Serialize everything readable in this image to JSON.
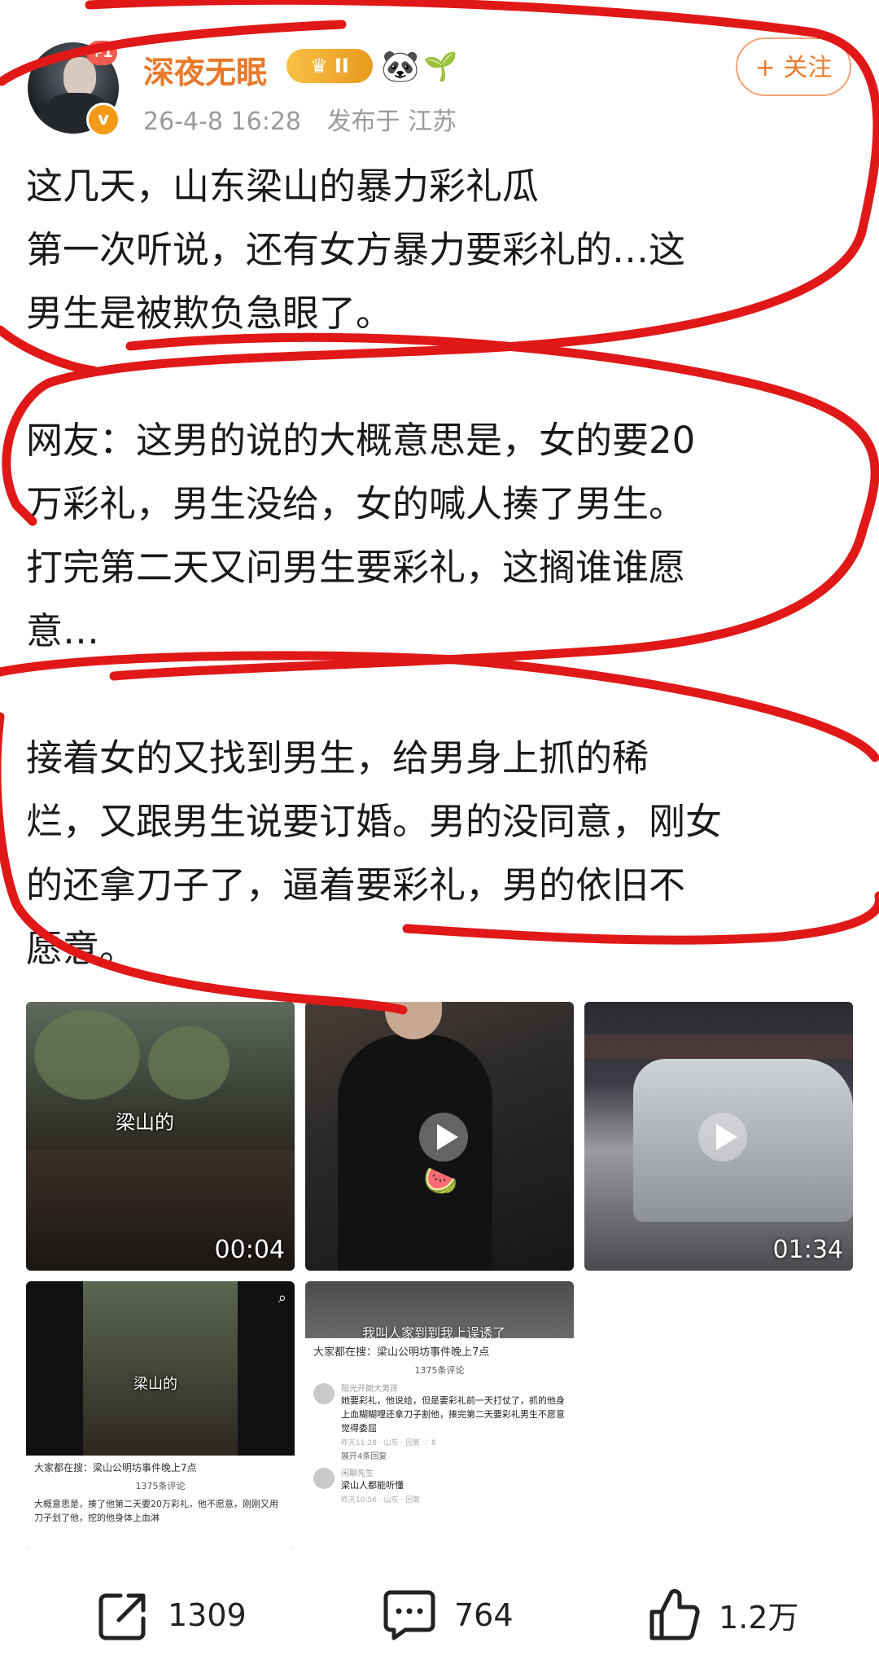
{
  "header": {
    "username": "深夜无眠",
    "plus_badge": "+1",
    "vip_badge": "II",
    "date": "26-4-8 16:28",
    "location": "发布于 江苏",
    "follow_label": "+ 关注",
    "verified_badge": "v"
  },
  "post": {
    "paragraphs": [
      [
        "这几天，山东梁山的暴力彩礼瓜",
        "第一次听说，还有女方暴力要彩礼的…这",
        "男生是被欺负急眼了。"
      ],
      [
        "网友：这男的说的大概意思是，女的要20",
        "万彩礼，男生没给，女的喊人揍了男生。",
        "打完第二天又问男生要彩礼，这搁谁谁愿",
        "意…"
      ],
      [
        "接着女的又找到男生，给男身上抓的稀",
        "烂，又跟男生说要订婚。男的没同意，刚女",
        "的还拿刀子了，逼着要彩礼，男的依旧不",
        "愿意。"
      ]
    ]
  },
  "media": {
    "tile1_caption": "梁山的",
    "tile1_duration": "00:04",
    "tile3_duration": "01:34",
    "tile4_caption": "梁山的",
    "tile4_search": "大家都在搜：梁山公明坊事件晚上7点",
    "tile4_count": "1375条评论",
    "tile4_comment": "大概意思是，揍了他第二天要20万彩礼，他不愿意，刚刚又用刀子划了他，挖的他身体上血淋",
    "tile5_caption": "我叫人家到到我上误诱了",
    "tile5_search": "大家都在搜：梁山公明坊事件晚上7点",
    "tile5_count": "1375条评论",
    "tile5_c1_name": "阳光开朗大男孩",
    "tile5_c1_text": "她要彩礼，他说给，但是要彩礼前一天打仗了，抓的他身上血糊糊哩还拿刀子割他，揍完第二天要彩礼男生不愿意觉得委屈",
    "tile5_c1_meta": "昨天11:28 · 山东 · 回复 ♡ 8",
    "tile5_expand": "展开4条回复",
    "tile5_c2_name": "闲聊先生",
    "tile5_c2_text": "梁山人都能听懂",
    "tile5_c2_meta": "昨天10:56 · 山东 · 回复"
  },
  "footer": {
    "share_count": "1309",
    "comment_count": "764",
    "like_count": "1.2万"
  },
  "colors": {
    "username": "#e7792b",
    "annotation_red": "#e01818",
    "follow": "#f07a2e"
  }
}
